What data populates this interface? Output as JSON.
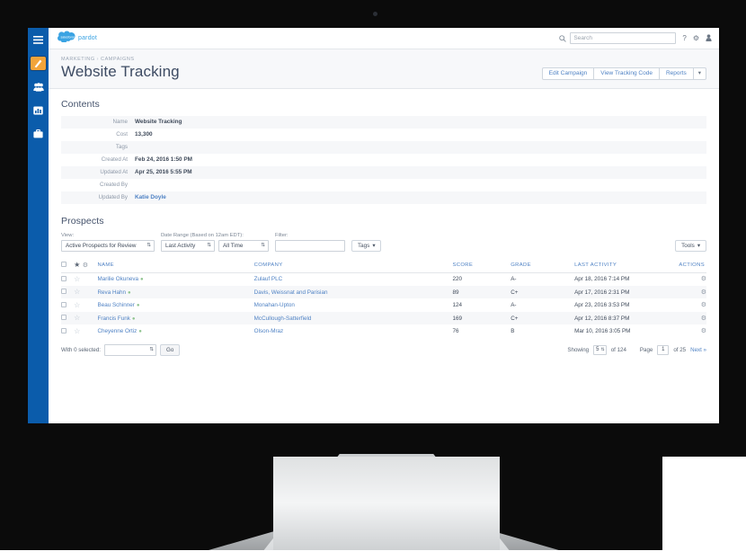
{
  "brand": {
    "word": "pardot",
    "cloud_alt": "salesforce-cloud"
  },
  "topbar": {
    "search_placeholder": "Search",
    "search_value": "",
    "help_glyph": "?",
    "settings_glyph": "⚙",
    "user_glyph": "♟"
  },
  "rail": {
    "items": [
      {
        "name": "menu",
        "glyph": "☰",
        "active": false
      },
      {
        "name": "marketing",
        "glyph": "",
        "active": true
      },
      {
        "name": "prospects",
        "glyph": "",
        "active": false
      },
      {
        "name": "reports",
        "glyph": "",
        "active": false
      },
      {
        "name": "admin",
        "glyph": "",
        "active": false
      }
    ]
  },
  "page": {
    "breadcrumb": [
      "MARKETING",
      "CAMPAIGNS"
    ],
    "breadcrumb_sep": "›",
    "title": "Website Tracking",
    "actions": [
      "Edit Campaign",
      "View Tracking Code",
      "Reports"
    ],
    "action_caret": "▾"
  },
  "contents": {
    "heading": "Contents",
    "rows": [
      {
        "label": "Name",
        "value": "Website Tracking",
        "link": false
      },
      {
        "label": "Cost",
        "value": "13,300",
        "link": false
      },
      {
        "label": "Tags",
        "value": "",
        "link": false
      },
      {
        "label": "Created At",
        "value": "Feb 24, 2016 1:50 PM",
        "link": false
      },
      {
        "label": "Updated At",
        "value": "Apr 25, 2016 5:55 PM",
        "link": false
      },
      {
        "label": "Created By",
        "value": "",
        "link": false
      },
      {
        "label": "Updated By",
        "value": "Katie Doyle",
        "link": true
      }
    ]
  },
  "prospects": {
    "heading": "Prospects",
    "filters": {
      "view_label": "View:",
      "view_value": "Active Prospects for Review",
      "date_label": "Date Range (Based on 12am EDT):",
      "date_field_value": "Last Activity",
      "date_range_value": "All Time",
      "filter_label": "Filter:",
      "filter_value": "",
      "tags_button": "Tags",
      "tools_button": "Tools",
      "caret": "▾",
      "stepper": "⇅"
    },
    "columns": [
      "",
      "",
      "NAME",
      "COMPANY",
      "SCORE",
      "GRADE",
      "LAST ACTIVITY",
      "ACTIONS"
    ],
    "header_star": "★",
    "header_gear": "⚙",
    "row_star": "☆",
    "row_gear": "⚙",
    "rows": [
      {
        "name": "Marilie Okuneva",
        "company": "Zulauf PLC",
        "score": "220",
        "grade": "A-",
        "last_activity": "Apr 18, 2016 7:14 PM"
      },
      {
        "name": "Reva Hahn",
        "company": "Davis, Weissnat and Parisian",
        "score": "89",
        "grade": "C+",
        "last_activity": "Apr 17, 2016 2:31 PM"
      },
      {
        "name": "Beau Schinner",
        "company": "Monahan-Upton",
        "score": "124",
        "grade": "A-",
        "last_activity": "Apr 23, 2016 3:53 PM"
      },
      {
        "name": "Francis Funk",
        "company": "McCullough-Satterfield",
        "score": "169",
        "grade": "C+",
        "last_activity": "Apr 12, 2016 8:37 PM"
      },
      {
        "name": "Cheyenne Ortiz",
        "company": "Olson-Mraz",
        "score": "76",
        "grade": "B",
        "last_activity": "Mar 10, 2016 3:05 PM"
      }
    ],
    "footer": {
      "with_selected_label": "With 0 selected:",
      "bulk_action_value": "",
      "go_button": "Go",
      "showing_label": "Showing",
      "showing_count": "5",
      "of_label_1": "of 124",
      "page_label": "Page",
      "page_number": "1",
      "of_label_2": "of 25",
      "next_link": "Next »"
    }
  },
  "colors": {
    "rail_blue": "#0b5cab",
    "accent_orange": "#f2a43a",
    "link_blue": "#4f82c4",
    "cloud_blue": "#3aa3e3"
  }
}
